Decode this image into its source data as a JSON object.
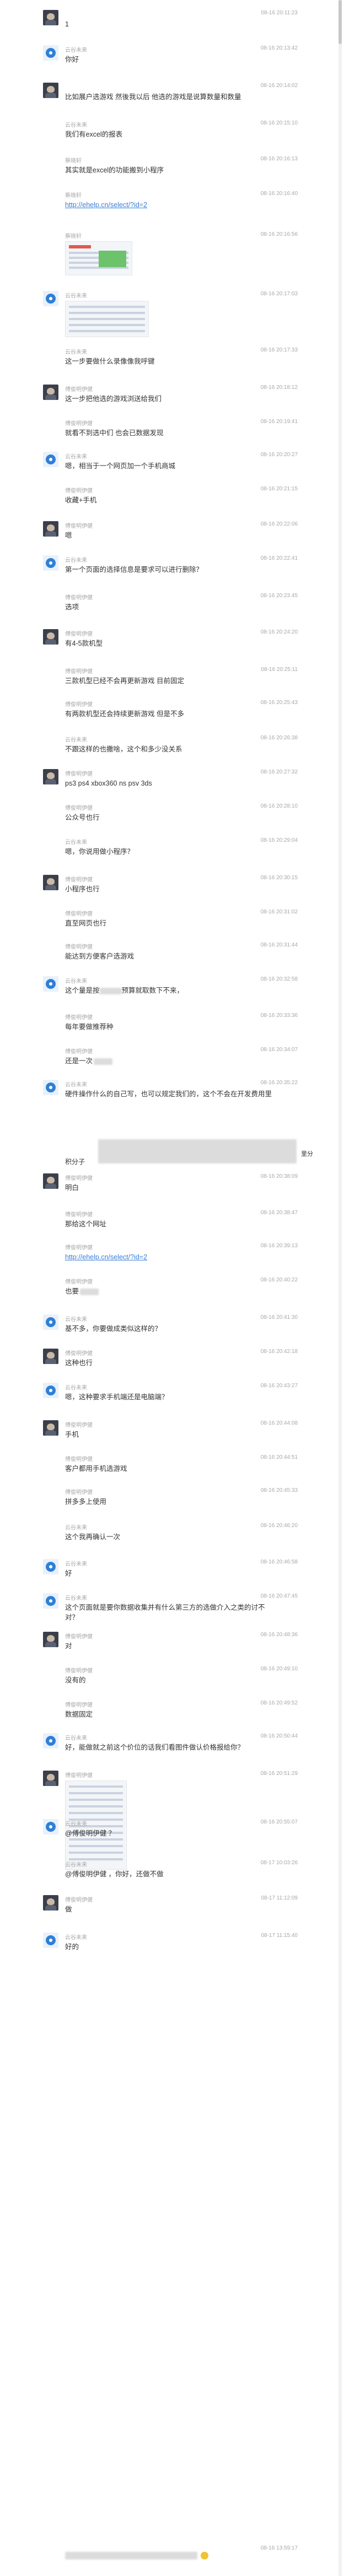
{
  "messages": [
    {
      "sender": "",
      "time": "08-16 20:11:23",
      "text": "1",
      "avatar": "dark"
    },
    {
      "sender": "云谷未来",
      "time": "08-16 20:13:42",
      "text": "你好",
      "avatar": "blue"
    },
    {
      "sender": "",
      "time": "08-16 20:14:02",
      "text": "比如展户选游戏 然後我以后 他选的游戏是说算数量和数量",
      "avatar": "dark"
    },
    {
      "sender": "云谷未来",
      "time": "08-16 20:15:10",
      "text": "我们有excel的报表",
      "avatar": "none"
    },
    {
      "sender": "蔡晓轩",
      "time": "08-16 20:16:13",
      "text": "其实就是excel的功能搬到小程序",
      "avatar": "none"
    },
    {
      "sender": "蔡晓轩",
      "time": "08-16 20:16:40",
      "text": "http://ehelp.cn/select/?id=2",
      "avatar": "none",
      "link": true
    },
    {
      "sender": "蔡晓轩",
      "time": "08-16 20:16:56",
      "text": "",
      "avatar": "none",
      "image": true
    },
    {
      "sender": "云谷未来",
      "time": "08-16 20:17:03",
      "text": "",
      "avatar": "blue",
      "image2": true
    },
    {
      "sender": "云谷未来",
      "time": "08-16 20:17:33",
      "text": "这一步要做什么录像像我呼键",
      "avatar": "none"
    },
    {
      "sender": "傅俊明伊健",
      "time": "08-16 20:18:12",
      "text": "这一步把他选的游戏浏送给我们",
      "avatar": "dark"
    },
    {
      "sender": "傅俊明伊健",
      "time": "08-16 20:19:41",
      "text": "就看不到选中们 也会已数据发现",
      "avatar": "none"
    },
    {
      "sender": "云谷未来",
      "time": "08-16 20:20:27",
      "text": "嗯，相当于一个网页加一个手机商城",
      "avatar": "blue"
    },
    {
      "sender": "傅俊明伊健",
      "time": "08-16 20:21:15",
      "text": "收藏+手机",
      "avatar": "none"
    },
    {
      "sender": "傅俊明伊健",
      "time": "08-16 20:22:06",
      "text": "嗯",
      "avatar": "dark"
    },
    {
      "sender": "云谷未来",
      "time": "08-16 20:22:41",
      "text": "第一个页面的选择信息是要求可以进行删除？",
      "avatar": "blue"
    },
    {
      "sender": "傅俊明伊健",
      "time": "08-16 20:23:45",
      "text": "选项",
      "avatar": "none"
    },
    {
      "sender": "傅俊明伊健",
      "time": "08-16 20:24:20",
      "text": "有4-5款机型",
      "avatar": "dark"
    },
    {
      "sender": "傅俊明伊健",
      "time": "08-16 20:25:11",
      "text": "三款机型已经不会再更新游戏 目前固定",
      "avatar": "none"
    },
    {
      "sender": "傅俊明伊健",
      "time": "08-16 20:25:43",
      "text": "有两款机型还会持续更新游戏 但是不多",
      "avatar": "none"
    },
    {
      "sender": "云谷未来",
      "time": "08-16 20:26:38",
      "text": "不跟这样的也撒啥，这个和多少没关系",
      "avatar": "none"
    },
    {
      "sender": "傅俊明伊健",
      "time": "08-16 20:27:32",
      "text": "ps3 ps4 xbox360 ns psv 3ds",
      "avatar": "dark"
    },
    {
      "sender": "傅俊明伊健",
      "time": "08-16 20:28:10",
      "text": "公众号也行",
      "avatar": "none"
    },
    {
      "sender": "云谷未来",
      "time": "08-16 20:29:04",
      "text": "嗯，你说用做小程序？",
      "avatar": "none"
    },
    {
      "sender": "傅俊明伊健",
      "time": "08-16 20:30:15",
      "text": "小程序也行",
      "avatar": "dark"
    },
    {
      "sender": "傅俊明伊健",
      "time": "08-16 20:31:02",
      "text": "直至网页也行",
      "avatar": "none"
    },
    {
      "sender": "傅俊明伊健",
      "time": "08-16 20:31:44",
      "text": "能达到方便客户选游戏",
      "avatar": "none"
    },
    {
      "sender": "云谷未来",
      "time": "08-16 20:32:58",
      "text": "这个量是按",
      "text2": "预算就取数下不来，",
      "avatar": "blue",
      "blurmid": true
    },
    {
      "sender": "傅俊明伊健",
      "time": "08-16 20:33:36",
      "text": "每年要做推荐种",
      "avatar": "none"
    },
    {
      "sender": "傅俊明伊健",
      "time": "08-16 20:34:07",
      "text": "还是一次",
      "avatar": "none",
      "blurend": true
    },
    {
      "sender": "云谷未来",
      "time": "08-16 20:35:22",
      "text": "硬件操作什么的自己写，也可以规定我们的，这个不会在开发费用里",
      "avatar": "blue"
    },
    {
      "sender": "",
      "time": "",
      "text": "",
      "avatar": "none",
      "blurblock": true,
      "tail": "积分子",
      "tail2": "里分"
    },
    {
      "sender": "傅俊明伊健",
      "time": "08-16 20:38:09",
      "text": "明白",
      "avatar": "dark"
    },
    {
      "sender": "傅俊明伊健",
      "time": "08-16 20:38:47",
      "text": "那给这个网址",
      "avatar": "none"
    },
    {
      "sender": "傅俊明伊健",
      "time": "08-16 20:39:13",
      "text": "http://ehelp.cn/select/?id=2",
      "avatar": "none",
      "link": true
    },
    {
      "sender": "傅俊明伊健",
      "time": "08-16 20:40:22",
      "text": "也要",
      "avatar": "none",
      "blurtail": true
    },
    {
      "sender": "云谷未来",
      "time": "08-16 20:41:30",
      "text": "基不多，你要做成类似这样的？",
      "avatar": "blue"
    },
    {
      "sender": "傅俊明伊健",
      "time": "08-16 20:42:18",
      "text": "这种也行",
      "avatar": "dark"
    },
    {
      "sender": "云谷未来",
      "time": "08-16 20:43:27",
      "text": "嗯，这种要求手机端还是电脑端？",
      "avatar": "blue"
    },
    {
      "sender": "傅俊明伊健",
      "time": "08-16 20:44:08",
      "text": "手机",
      "avatar": "dark"
    },
    {
      "sender": "傅俊明伊健",
      "time": "08-16 20:44:51",
      "text": "客户都用手机选游戏",
      "avatar": "none"
    },
    {
      "sender": "傅俊明伊健",
      "time": "08-16 20:45:33",
      "text": "拼多多上使用",
      "avatar": "none"
    },
    {
      "sender": "云谷未来",
      "time": "08-16 20:46:20",
      "text": "这个我再确认一次",
      "avatar": "none"
    },
    {
      "sender": "云谷未来",
      "time": "08-16 20:46:58",
      "text": "好",
      "avatar": "blue"
    },
    {
      "sender": "云谷未来",
      "time": "08-16 20:47:45",
      "text": "这个页面就是要你数据收集并有什么第三方的选做介入之类的讨不对？",
      "avatar": "blue"
    },
    {
      "sender": "傅俊明伊健",
      "time": "08-16 20:48:36",
      "text": "对",
      "avatar": "dark"
    },
    {
      "sender": "傅俊明伊健",
      "time": "08-16 20:49:10",
      "text": "没有的",
      "avatar": "none"
    },
    {
      "sender": "傅俊明伊健",
      "time": "08-16 20:49:52",
      "text": "数据固定",
      "avatar": "none"
    },
    {
      "sender": "云谷未来",
      "time": "08-16 20:50:44",
      "text": "好，能做就之前这个价位的话我们看图件做认价格报给你？",
      "avatar": "blue"
    },
    {
      "sender": "傅俊明伊健",
      "time": "08-16 20:51:29",
      "text": "",
      "avatar": "dark",
      "phone": true
    },
    {
      "sender": "云谷未来",
      "time": "08-16 20:55:07",
      "text": "@傅俊明伊健 ？",
      "avatar": "blue"
    },
    {
      "sender": "云谷未来",
      "time": "08-17 10:03:26",
      "text": "@傅俊明伊健 ，你好，还做不做",
      "avatar": "none"
    },
    {
      "sender": "傅俊明伊健",
      "time": "08-17 11:12:09",
      "text": "做",
      "avatar": "dark"
    },
    {
      "sender": "云谷未来",
      "time": "08-17 11:15:40",
      "text": "好的",
      "avatar": "blue"
    },
    {
      "sender": "",
      "time": "08-16 13:59:17",
      "text": "",
      "avatar": "none",
      "lastblur": true
    }
  ],
  "colors": {
    "link": "#3a7fd5",
    "meta": "#a8a8a8",
    "text": "#333333",
    "bg": "#ffffff"
  },
  "icons": {
    "avatar_blue": "cloud-avatar-icon",
    "avatar_dark": "user-photo-avatar-icon"
  }
}
